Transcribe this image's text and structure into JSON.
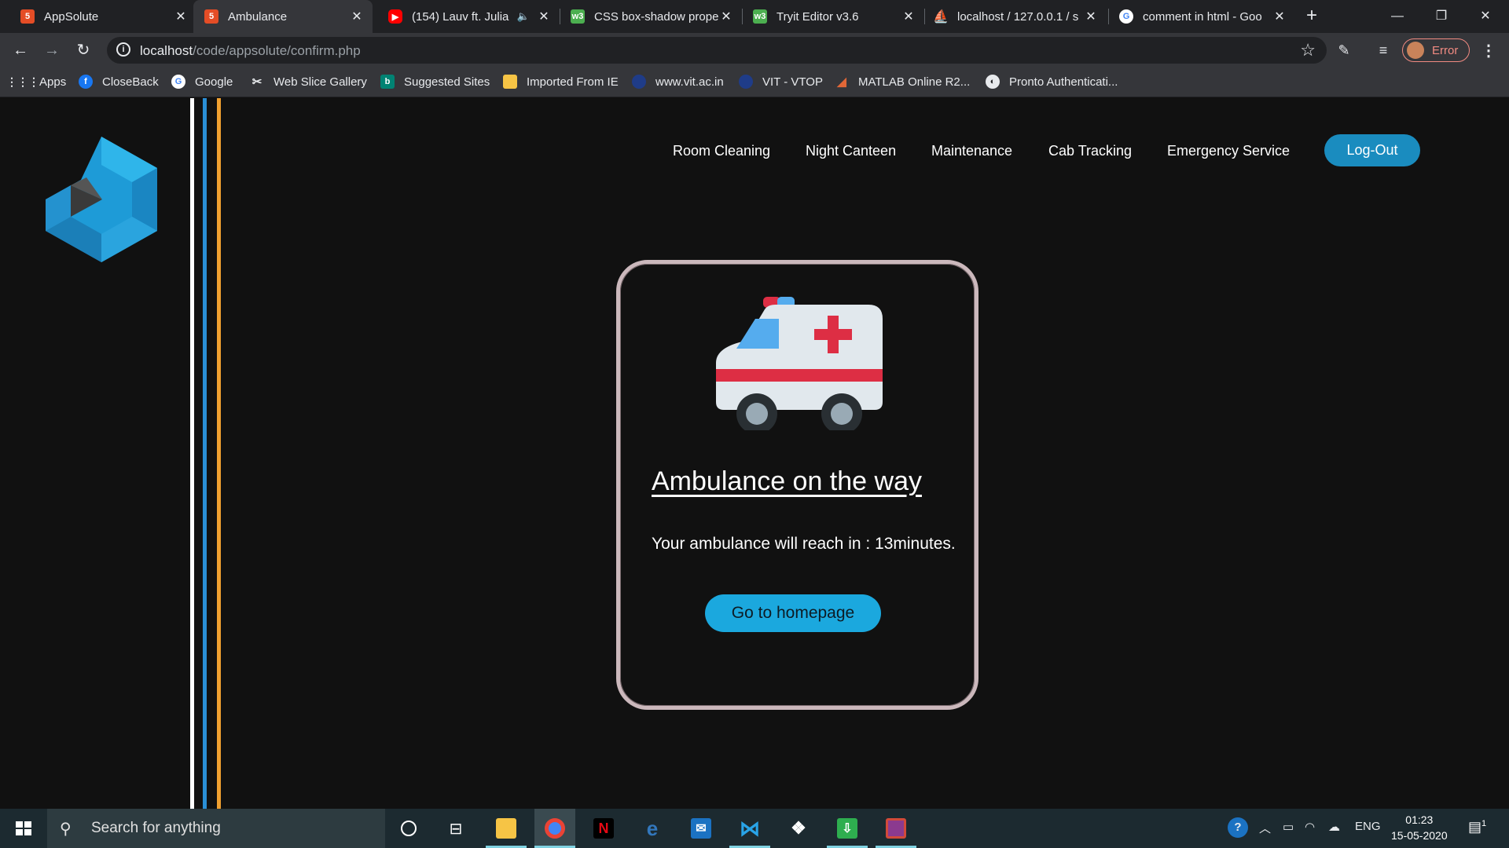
{
  "browser": {
    "tabs": [
      {
        "title": "AppSolute",
        "favicon": "html5-icon",
        "color": "#e44d26"
      },
      {
        "title": "Ambulance",
        "favicon": "html5-icon",
        "color": "#e44d26"
      },
      {
        "title": "(154) Lauv ft. Julia",
        "favicon": "youtube-icon",
        "color": "#ff0000"
      },
      {
        "title": "CSS box-shadow prope",
        "favicon": "w3schools-icon",
        "color": "#4caf50"
      },
      {
        "title": "Tryit Editor v3.6",
        "favicon": "w3schools-icon",
        "color": "#4caf50"
      },
      {
        "title": "localhost / 127.0.0.1 / s",
        "favicon": "phpmyadmin-icon",
        "color": "#f0a030"
      },
      {
        "title": "comment in html - Goo",
        "favicon": "google-icon",
        "color": "#4285f4"
      }
    ],
    "address": {
      "host": "localhost",
      "path": "/code/appsolute/confirm.php"
    },
    "profile_label": "Error",
    "bookmarks": [
      "Apps",
      "CloseBack",
      "Google",
      "Web Slice Gallery",
      "Suggested Sites",
      "Imported From IE",
      "www.vit.ac.in",
      "VIT - VTOP",
      "MATLAB Online R2...",
      "Pronto Authenticati..."
    ]
  },
  "page": {
    "nav": [
      "Room Cleaning",
      "Night Canteen",
      "Maintenance",
      "Cab Tracking",
      "Emergency Service"
    ],
    "logout_label": "Log-Out",
    "card": {
      "title": "Ambulance on the way",
      "eta_text": "Your ambulance will reach in : 13minutes.",
      "home_button": "Go to homepage"
    },
    "colors": {
      "accent": "#1ba8de",
      "line_blue": "#2a8fd6",
      "line_orange": "#f0a030",
      "card_border": "#cbb8bc"
    }
  },
  "taskbar": {
    "search_placeholder": "Search for anything",
    "apps": [
      "file-explorer-icon",
      "chrome-icon",
      "netflix-icon",
      "edge-icon",
      "mail-icon",
      "vscode-icon",
      "dropbox-icon",
      "cloud-download-icon",
      "winrar-icon"
    ],
    "lang": "ENG",
    "time": "01:23",
    "date": "15-05-2020",
    "notifications": "1"
  }
}
